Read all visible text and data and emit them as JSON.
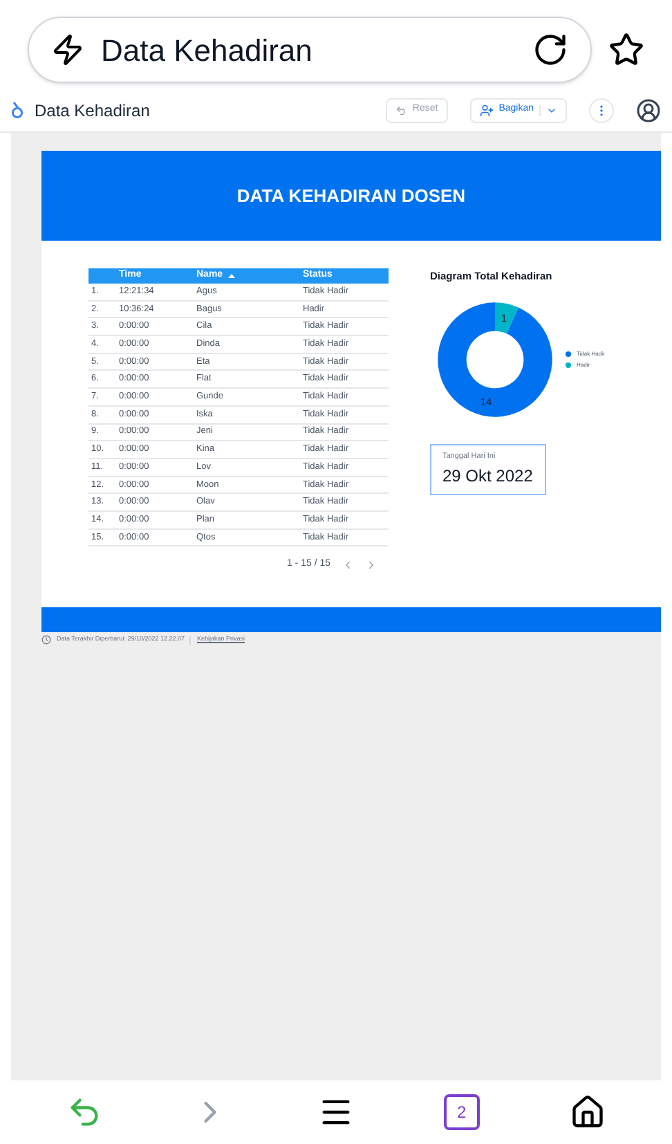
{
  "browser": {
    "url": "Data Kehadiran",
    "tab_count": "2"
  },
  "app_bar": {
    "title": "Data Kehadiran",
    "reset": "Reset",
    "share": "Bagikan"
  },
  "report": {
    "title": "DATA KEHADIRAN DOSEN",
    "table": {
      "columns": [
        {
          "label": "Time",
          "sorted": false
        },
        {
          "label": "Name",
          "sorted": true
        },
        {
          "label": "Status",
          "sorted": false
        }
      ],
      "rows": [
        {
          "number": "1.",
          "cells": [
            "12:21:34",
            "Agus",
            "Tidak Hadir"
          ]
        },
        {
          "number": "2.",
          "cells": [
            "10:36:24",
            "Bagus",
            "Hadir"
          ]
        },
        {
          "number": "3.",
          "cells": [
            "0:00:00",
            "Cila",
            "Tidak Hadir"
          ]
        },
        {
          "number": "4.",
          "cells": [
            "0:00:00",
            "Dinda",
            "Tidak Hadir"
          ]
        },
        {
          "number": "5.",
          "cells": [
            "0:00:00",
            "Eta",
            "Tidak Hadir"
          ]
        },
        {
          "number": "6.",
          "cells": [
            "0:00:00",
            "Flat",
            "Tidak Hadir"
          ]
        },
        {
          "number": "7.",
          "cells": [
            "0:00:00",
            "Gunde",
            "Tidak Hadir"
          ]
        },
        {
          "number": "8.",
          "cells": [
            "0:00:00",
            "Iska",
            "Tidak Hadir"
          ]
        },
        {
          "number": "9.",
          "cells": [
            "0:00:00",
            "Jeni",
            "Tidak Hadir"
          ]
        },
        {
          "number": "10.",
          "cells": [
            "0:00:00",
            "Kina",
            "Tidak Hadir"
          ]
        },
        {
          "number": "11.",
          "cells": [
            "0:00:00",
            "Lov",
            "Tidak Hadir"
          ]
        },
        {
          "number": "12.",
          "cells": [
            "0:00:00",
            "Moon",
            "Tidak Hadir"
          ]
        },
        {
          "number": "13.",
          "cells": [
            "0:00:00",
            "Olav",
            "Tidak Hadir"
          ]
        },
        {
          "number": "14.",
          "cells": [
            "0:00:00",
            "Plan",
            "Tidak Hadir"
          ]
        },
        {
          "number": "15.",
          "cells": [
            "0:00:00",
            "Qtos",
            "Tidak Hadir"
          ]
        }
      ],
      "pagination": "1 - 15 / 15"
    },
    "chart": {
      "chart_data": {
        "type": "donut",
        "title": "Diagram Total Kehadiran",
        "categories": [
          "Tidak Hadir",
          "Hadir"
        ],
        "values": [
          14,
          1
        ],
        "colors": [
          "#0072f0",
          "#00b5c8"
        ],
        "legend": "right",
        "data_labels": true
      }
    },
    "date_card": {
      "label": "Tanggal Hari Ini",
      "value": "29 Okt 2022"
    }
  },
  "footer": {
    "updated": "Data Terakhir Diperbarui: 29/10/2022 12.22.07",
    "privacy": "Kebijakan Privasi"
  }
}
